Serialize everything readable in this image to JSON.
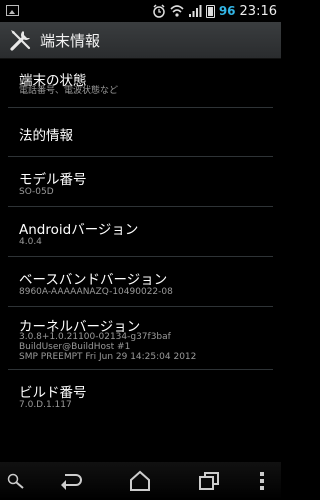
{
  "status_bar": {
    "battery_level": "96",
    "time": "23:16",
    "icons": [
      "picture-notification-icon",
      "alarm-icon",
      "wifi-icon",
      "signal-icon",
      "battery-icon"
    ]
  },
  "action_bar": {
    "title": "端末情報",
    "icon": "settings-wrench-icon"
  },
  "items": [
    {
      "title": "端末の状態",
      "subtitles": [
        "電話番号、電波状態など"
      ]
    },
    {
      "title": "法的情報",
      "subtitles": []
    },
    {
      "title": "モデル番号",
      "subtitles": [
        "SO-05D"
      ]
    },
    {
      "title": "Androidバージョン",
      "subtitles": [
        "4.0.4"
      ]
    },
    {
      "title": "ベースバンドバージョン",
      "subtitles": [
        "8960A-AAAAANAZQ-10490022-08"
      ]
    },
    {
      "title": "カーネルバージョン",
      "subtitles": [
        "3.0.8+1.0.21100-02134-g37f3baf",
        "BuildUser@BuildHost #1",
        "SMP PREEMPT Fri Jun 29 14:25:04 2012"
      ]
    },
    {
      "title": "ビルド番号",
      "subtitles": [
        "7.0.D.1.117"
      ]
    }
  ],
  "nav_bar": {
    "icons": [
      "search-icon",
      "back-icon",
      "home-icon",
      "recent-apps-icon",
      "menu-icon"
    ]
  }
}
